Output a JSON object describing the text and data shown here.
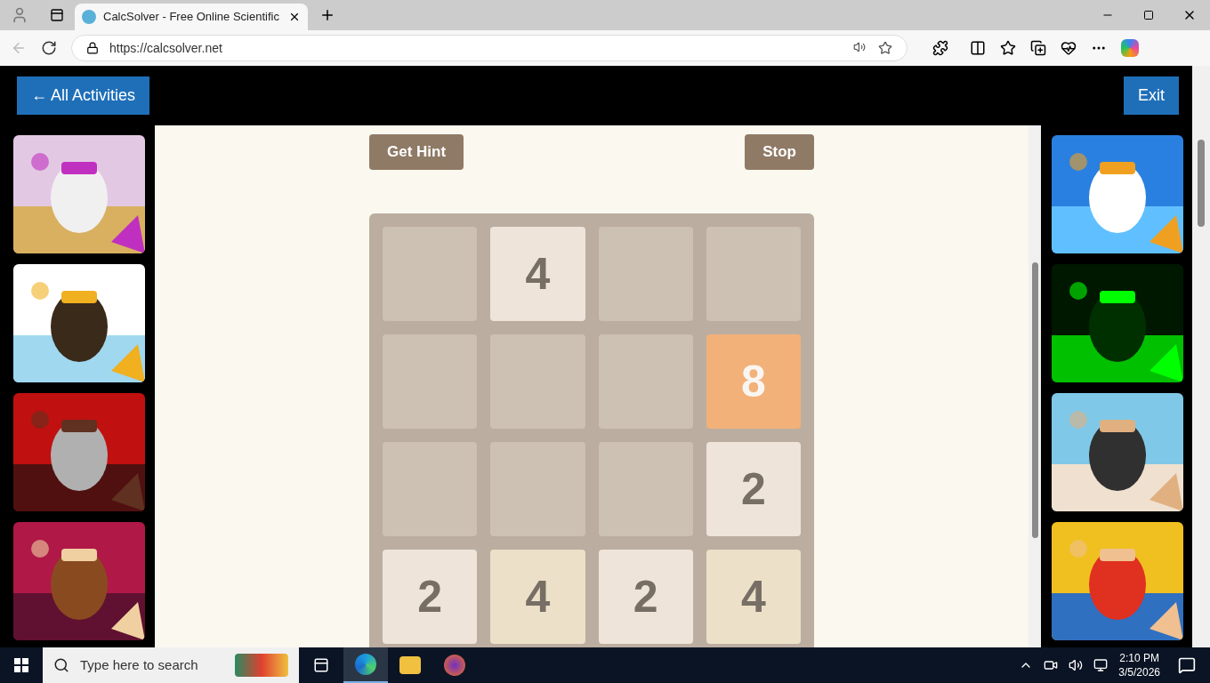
{
  "browser": {
    "tab_title": "CalcSolver - Free Online Scientific",
    "url": "https://calcsolver.net"
  },
  "header": {
    "back_button": "← All Activities",
    "exit_button": "Exit"
  },
  "game": {
    "hint_button": "Get Hint",
    "stop_button": "Stop",
    "tiles": [
      {
        "kind": "empty"
      },
      {
        "kind": "tile",
        "value": "4",
        "color": "#eee4da"
      },
      {
        "kind": "empty"
      },
      {
        "kind": "empty"
      },
      {
        "kind": "empty"
      },
      {
        "kind": "empty"
      },
      {
        "kind": "empty"
      },
      {
        "kind": "tile",
        "value": "8",
        "color": "#f2b179"
      },
      {
        "kind": "empty"
      },
      {
        "kind": "empty"
      },
      {
        "kind": "empty"
      },
      {
        "kind": "tile",
        "value": "2",
        "color": "#eee4da"
      },
      {
        "kind": "tile",
        "value": "2",
        "color": "#eee4da"
      },
      {
        "kind": "tile",
        "value": "4",
        "color": "#ede0c8"
      },
      {
        "kind": "tile",
        "value": "2",
        "color": "#eee4da"
      },
      {
        "kind": "tile",
        "value": "4",
        "color": "#ede0c8"
      }
    ]
  },
  "taskbar": {
    "search_placeholder": "Type here to search",
    "time": "2:10 PM",
    "date": "3/5/2026"
  }
}
